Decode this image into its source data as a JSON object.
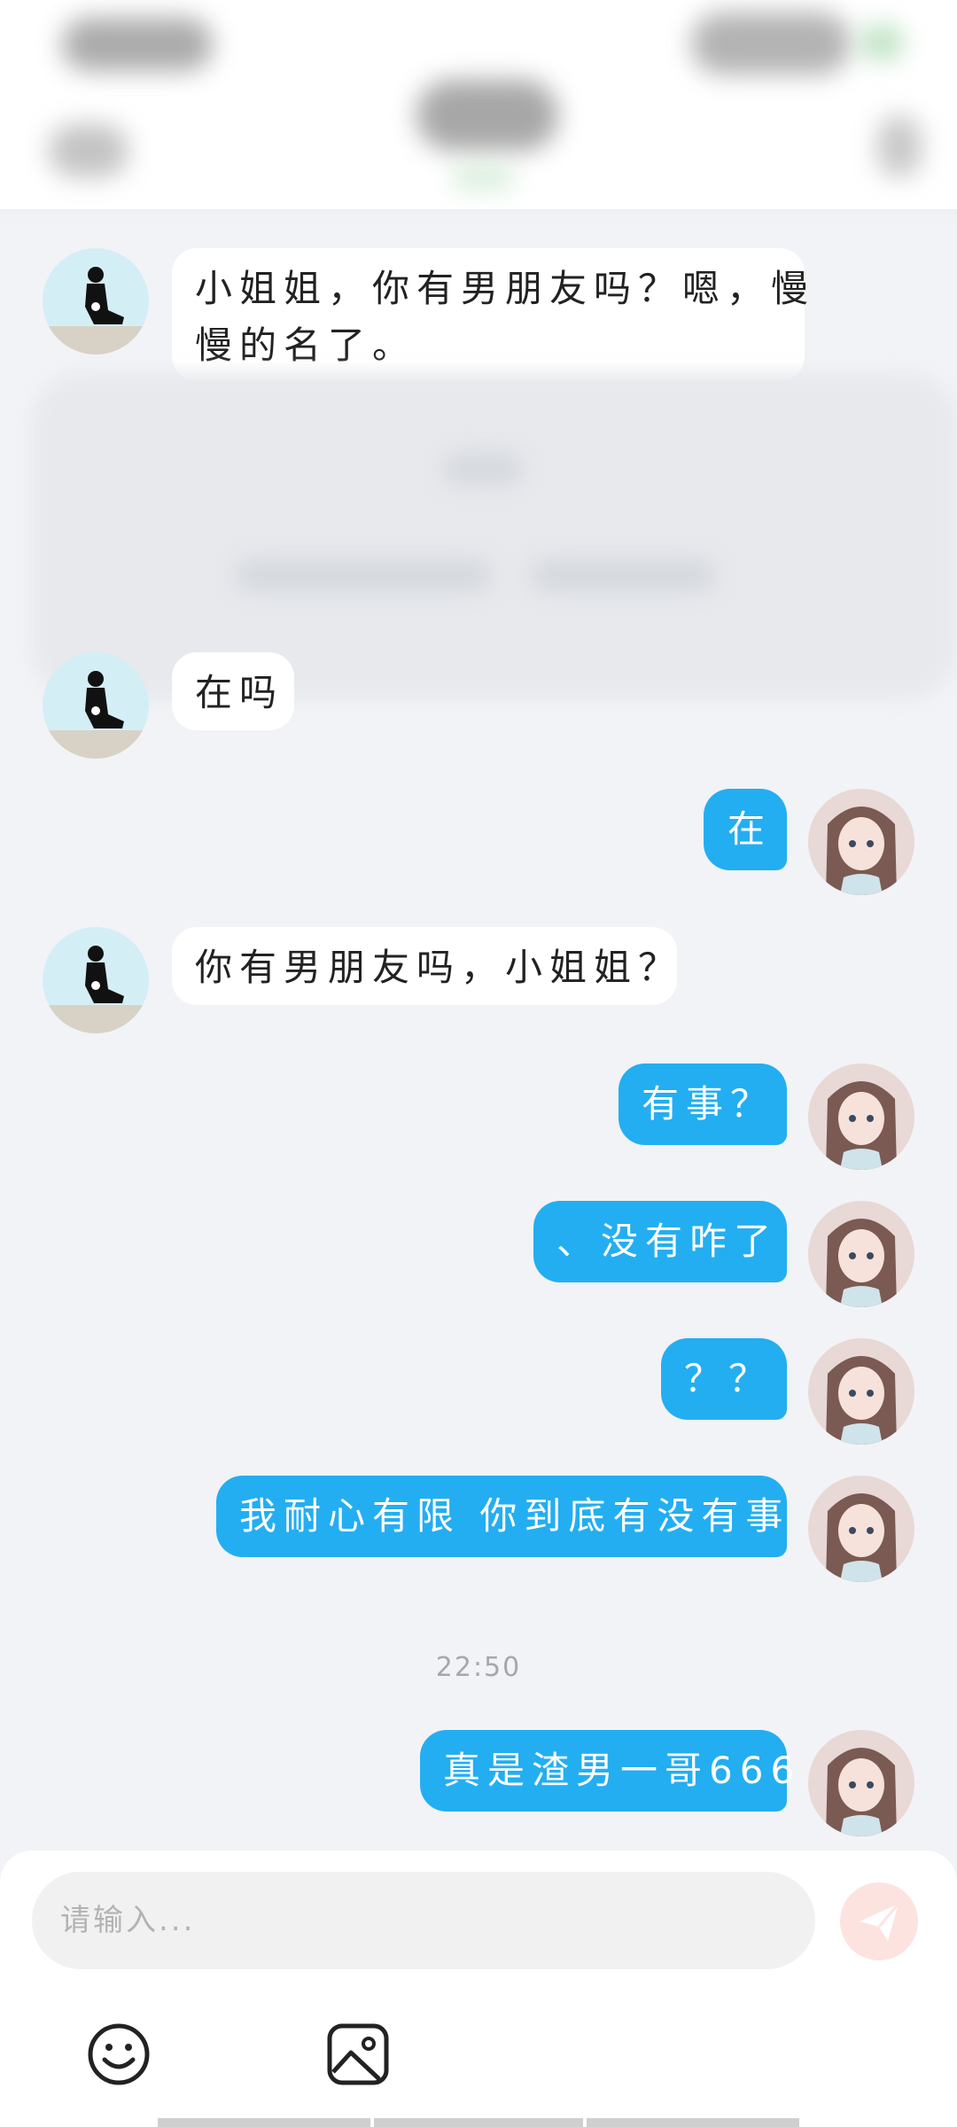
{
  "colors": {
    "accent": "#23aef2",
    "background": "#f2f3f6",
    "send": "#fde3e0"
  },
  "messages": [
    {
      "side": "left",
      "text": "小姐姐，你有男朋友吗？嗯，慢",
      "text2": "慢的名了。"
    },
    {
      "side": "left",
      "text": "在吗"
    },
    {
      "side": "right",
      "text": "在"
    },
    {
      "side": "left",
      "text": "你有男朋友吗，小姐姐？"
    },
    {
      "side": "right",
      "text": "有事？"
    },
    {
      "side": "right",
      "text": "、没有咋了"
    },
    {
      "side": "right",
      "text": "？？"
    },
    {
      "side": "right",
      "text": "我耐心有限 你到底有没有事"
    },
    {
      "side": "right",
      "text": "真是渣男一哥666"
    }
  ],
  "timestamp": "22:50",
  "composer": {
    "placeholder": "请输入...",
    "send_icon": "send-icon",
    "emoji_icon": "emoji-icon",
    "image_icon": "image-icon"
  }
}
